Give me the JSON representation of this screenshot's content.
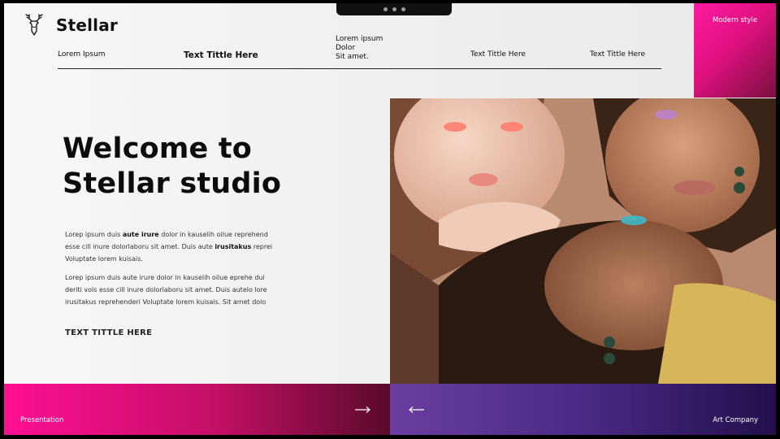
{
  "brand": {
    "name": "Stellar",
    "logo_icon": "deer-head-icon"
  },
  "nav": {
    "items": [
      {
        "label": "Lorem Ipsum"
      },
      {
        "label": "Text Tittle Here"
      },
      {
        "label": "Lorem ipsum\nDolor\nSit amet."
      },
      {
        "label": "Text Tittle Here"
      },
      {
        "label": "Text Tittle Here"
      }
    ]
  },
  "badge": {
    "label": "Modern style"
  },
  "hero": {
    "title_line1": "Welcome to",
    "title_line2": "Stellar studio",
    "p1_a": "Lorep  ipsum duis ",
    "p1_b": "aute irure",
    "p1_c": " dolor in kauselih oilue reprehend esse cill inure dolorlaboru sit amet. Duis aute ",
    "p1_d": "irusitakus",
    "p1_e": " reprei Voluptate lorem kuisais.",
    "p2": "Lorep  ipsum duis aute irure dolor in kauselih oilue eprehe dui deriti vols esse cill inure dolorlaboru sit amet. Duis autelo lore irusitakus reprehenderi Voluptate lorem kuisais. Sit amet dolo",
    "cta": "TEXT TITTLE HERE"
  },
  "footer": {
    "left_label": "Presentation",
    "right_label": "Art Company",
    "next_icon": "arrow-right-icon",
    "prev_icon": "arrow-left-icon"
  },
  "colors": {
    "magenta": "#ff0f93",
    "purple": "#4a2a86"
  }
}
